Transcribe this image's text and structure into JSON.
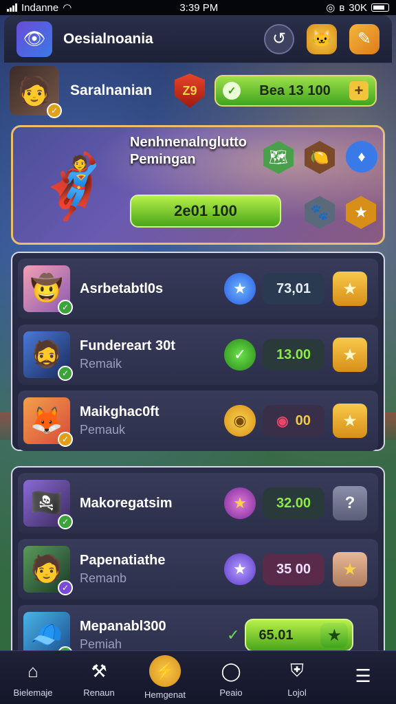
{
  "status_bar": {
    "carrier": "Indanne",
    "time": "3:39 PM",
    "battery": "30K"
  },
  "header": {
    "app_title": "Oesialnoania"
  },
  "profile": {
    "name": "Saralnanian",
    "level": "Z9",
    "balance": "Bea 13 100"
  },
  "featured": {
    "title": "Nenhnenalnglutto",
    "subtitle": "Pemingan",
    "button_label": "2e01 100"
  },
  "list1": [
    {
      "title": "Asrbetabtl0s",
      "subtitle": "",
      "value": "73,01",
      "value_style": "blue"
    },
    {
      "title": "Fundereart 30t",
      "subtitle": "Remaik",
      "value": "13.00",
      "value_style": "green"
    },
    {
      "title": "Maikghac0ft",
      "subtitle": "Pemauk",
      "value": "00",
      "value_style": "gold"
    }
  ],
  "list2": [
    {
      "title": "Makoregatsim",
      "subtitle": "",
      "value": "32.00",
      "value_style": "green"
    },
    {
      "title": "Papenatiathe",
      "subtitle": "Remanb",
      "value": "35 00",
      "value_style": "plum"
    },
    {
      "title": "Mepanabl300",
      "subtitle": "Pemiah",
      "value": "65.01",
      "value_style": "pill"
    }
  ],
  "nav": [
    {
      "label": "Bielemaje",
      "icon": "home-icon"
    },
    {
      "label": "Renaun",
      "icon": "hammer-icon"
    },
    {
      "label": "Hemgenat",
      "icon": "lightning-icon"
    },
    {
      "label": "Peaio",
      "icon": "chat-icon"
    },
    {
      "label": "Lojol",
      "icon": "shield-icon"
    },
    {
      "label": "",
      "icon": "menu-icon"
    }
  ]
}
